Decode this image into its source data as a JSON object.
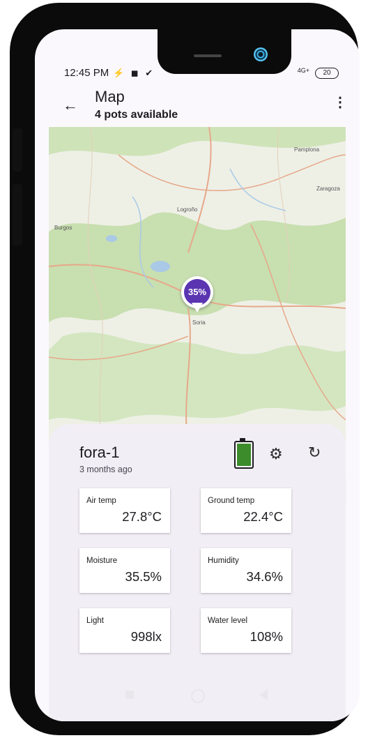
{
  "status_bar": {
    "time": "12:45 PM",
    "icons_text": "⚡ ◼ ✔",
    "signal": "4G+",
    "battery": "20"
  },
  "app_bar": {
    "back_glyph": "←",
    "title": "Map",
    "subtitle": "4 pots available",
    "more_glyph": "⋮"
  },
  "map": {
    "marker_text": "35%",
    "marker_color": "#5b35b1",
    "fab_glyph": "+",
    "places": [
      "Pamplona",
      "Logroño",
      "Soria",
      "Burgos",
      "Zaragoza"
    ]
  },
  "pot": {
    "name": "fora-1",
    "last_seen": "3 months ago",
    "battery_level": 1.0,
    "battery_color": "#3c8c2c",
    "gear_glyph": "⚙",
    "refresh_glyph": "↻",
    "metrics": [
      {
        "label": "Air temp",
        "value": "27.8°C"
      },
      {
        "label": "Ground temp",
        "value": "22.4°C"
      },
      {
        "label": "Moisture",
        "value": "35.5%"
      },
      {
        "label": "Humidity",
        "value": "34.6%"
      },
      {
        "label": "Light",
        "value": "998lx"
      },
      {
        "label": "Water level",
        "value": "108%"
      }
    ]
  },
  "colors": {
    "screen_bg": "#fbf8fd",
    "sheet_bg": "#f2eef6",
    "fab_bg": "#eaddff",
    "map_green": "#c8dfb0",
    "map_road": "#e7a88a"
  }
}
